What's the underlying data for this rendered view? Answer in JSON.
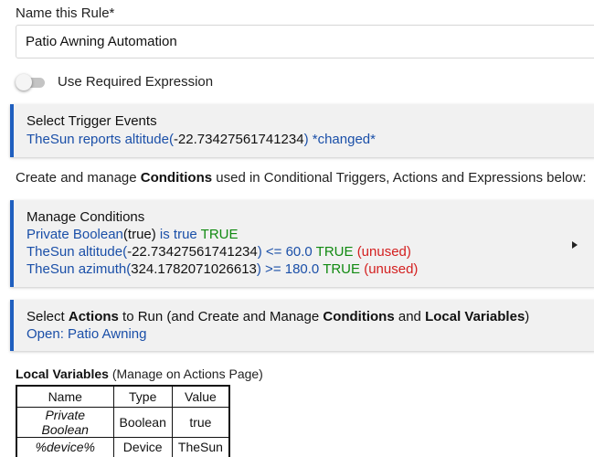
{
  "rule_name": {
    "label": "Name this Rule*",
    "value": "Patio Awning Automation"
  },
  "required_expression": {
    "label": "Use Required Expression",
    "enabled": false
  },
  "trigger_panel": {
    "title": "Select Trigger Events",
    "device": "TheSun",
    "reports": "reports altitude(",
    "value": "-22.73427561741234",
    "close": ")",
    "changed": "*changed*"
  },
  "conditions_intro": {
    "prefix": "Create and manage ",
    "bold": "Conditions",
    "suffix": " used in Conditional Triggers, Actions and Expressions below:"
  },
  "conditions_panel": {
    "title": "Manage Conditions",
    "rows": [
      {
        "part1": "Private Boolean",
        "part2": "(true)",
        "part3": " is true ",
        "result": "TRUE",
        "unused": ""
      },
      {
        "part1": "TheSun altitude(",
        "part2": "-22.73427561741234",
        "part3": ") <= 60.0 ",
        "result": "TRUE",
        "unused": "(unused)"
      },
      {
        "part1": "TheSun azimuth(",
        "part2": "324.1782071026613",
        "part3": ") >= 180.0 ",
        "result": "TRUE",
        "unused": "(unused)"
      }
    ]
  },
  "actions_panel": {
    "t1": "Select ",
    "b1": "Actions",
    "t2": " to Run (and Create and Manage ",
    "b2": "Conditions",
    "t3": " and ",
    "b3": "Local Variables",
    "t4": ")",
    "action": "Open: Patio Awning"
  },
  "local_variables": {
    "title": "Local Variables",
    "note": " (Manage on Actions Page)",
    "headers": [
      "Name",
      "Type",
      "Value"
    ],
    "rows": [
      [
        "Private Boolean",
        "Boolean",
        "true"
      ],
      [
        "%device%",
        "Device",
        "TheSun"
      ]
    ]
  },
  "colors": {
    "link_blue": "#1a4fa8",
    "true_green": "#118a11",
    "unused_red": "#d42020",
    "panel_accent": "#1f5fbf"
  }
}
